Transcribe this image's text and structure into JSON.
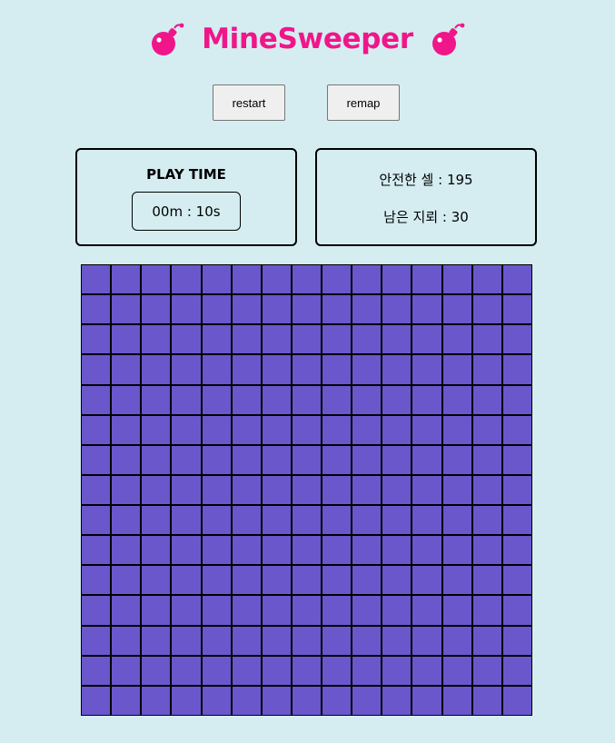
{
  "header": {
    "title": "MineSweeper",
    "left_icon": "bomb-icon",
    "right_icon": "bomb-icon",
    "title_color": "#f0168a"
  },
  "controls": {
    "restart_label": "restart",
    "remap_label": "remap"
  },
  "timer": {
    "label": "PLAY TIME",
    "value": "00m : 10s"
  },
  "stats": {
    "safe_cells": "안전한 셀 : 195",
    "remaining_mines": "남은 지뢰 : 30"
  },
  "board": {
    "rows": 15,
    "cols": 15,
    "cell_color": "#6a57cc",
    "grid_color": "#000000"
  }
}
